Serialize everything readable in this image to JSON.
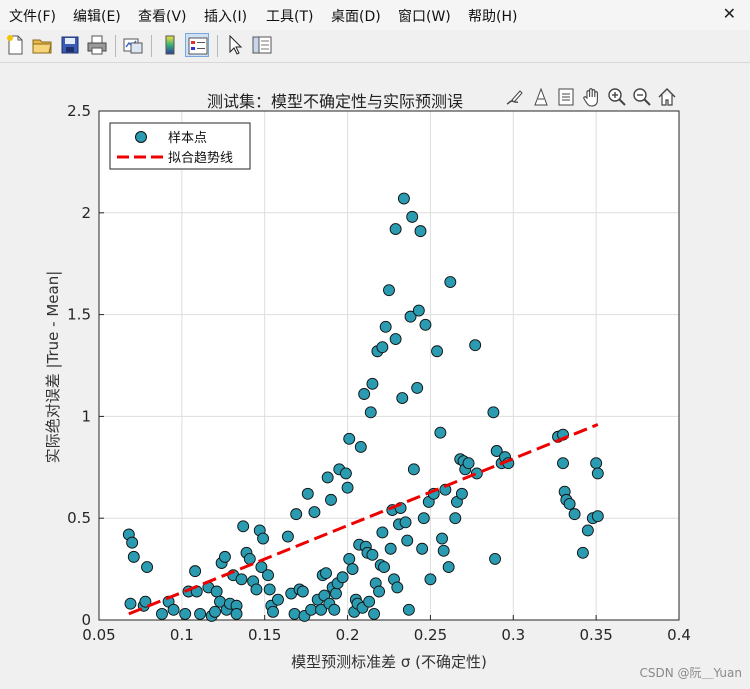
{
  "menu": {
    "items": [
      "文件(F)",
      "编辑(E)",
      "查看(V)",
      "插入(I)",
      "工具(T)",
      "桌面(D)",
      "窗口(W)",
      "帮助(H)"
    ]
  },
  "toolbar": {
    "icons": [
      "new-figure-icon",
      "open-file-icon",
      "save-icon",
      "print-icon",
      "link-plot-icon",
      "colorbar-icon",
      "legend-icon",
      "pointer-icon",
      "property-inspector-icon"
    ]
  },
  "axes_toolbar": {
    "icons": [
      "brush-icon",
      "data-tip-icon",
      "export-icon",
      "pan-hand-icon",
      "zoom-in-icon",
      "zoom-out-icon",
      "home-icon"
    ]
  },
  "watermark": "CSDN @阮＿Yuan",
  "chart_data": {
    "type": "scatter",
    "title": "测试集：模型不确定性与实际预测误",
    "xlabel": "模型预测标准差 σ (不确定性)",
    "ylabel": "实际绝对误差 |True - Mean|",
    "xlim": [
      0.05,
      0.4
    ],
    "ylim": [
      0,
      2.5
    ],
    "xticks": [
      0.05,
      0.1,
      0.15,
      0.2,
      0.25,
      0.3,
      0.35,
      0.4
    ],
    "xtick_labels": [
      "0.05",
      "0.1",
      "0.15",
      "0.2",
      "0.25",
      "0.3",
      "0.35",
      "0.4"
    ],
    "yticks": [
      0,
      0.5,
      1,
      1.5,
      2,
      2.5
    ],
    "ytick_labels": [
      "0",
      "0.5",
      "1",
      "1.5",
      "2",
      "2.5"
    ],
    "grid": true,
    "legend_position": "top-left",
    "colors": {
      "marker": "#2a9bb0",
      "marker_edge": "#111111",
      "trend": "#ee0000"
    },
    "series": [
      {
        "name": "样本点",
        "points": [
          [
            0.068,
            0.42
          ],
          [
            0.07,
            0.38
          ],
          [
            0.071,
            0.31
          ],
          [
            0.069,
            0.08
          ],
          [
            0.077,
            0.07
          ],
          [
            0.079,
            0.26
          ],
          [
            0.078,
            0.09
          ],
          [
            0.088,
            0.03
          ],
          [
            0.092,
            0.09
          ],
          [
            0.095,
            0.05
          ],
          [
            0.102,
            0.03
          ],
          [
            0.104,
            0.14
          ],
          [
            0.108,
            0.24
          ],
          [
            0.109,
            0.14
          ],
          [
            0.111,
            0.03
          ],
          [
            0.116,
            0.16
          ],
          [
            0.118,
            0.02
          ],
          [
            0.12,
            0.04
          ],
          [
            0.121,
            0.14
          ],
          [
            0.123,
            0.09
          ],
          [
            0.124,
            0.28
          ],
          [
            0.126,
            0.31
          ],
          [
            0.127,
            0.05
          ],
          [
            0.129,
            0.08
          ],
          [
            0.131,
            0.22
          ],
          [
            0.133,
            0.07
          ],
          [
            0.133,
            0.03
          ],
          [
            0.136,
            0.2
          ],
          [
            0.137,
            0.46
          ],
          [
            0.139,
            0.33
          ],
          [
            0.141,
            0.3
          ],
          [
            0.143,
            0.19
          ],
          [
            0.145,
            0.15
          ],
          [
            0.147,
            0.44
          ],
          [
            0.148,
            0.26
          ],
          [
            0.149,
            0.4
          ],
          [
            0.152,
            0.22
          ],
          [
            0.153,
            0.15
          ],
          [
            0.154,
            0.07
          ],
          [
            0.155,
            0.04
          ],
          [
            0.158,
            0.1
          ],
          [
            0.164,
            0.41
          ],
          [
            0.166,
            0.13
          ],
          [
            0.168,
            0.03
          ],
          [
            0.169,
            0.52
          ],
          [
            0.171,
            0.15
          ],
          [
            0.173,
            0.14
          ],
          [
            0.174,
            0.02
          ],
          [
            0.176,
            0.62
          ],
          [
            0.178,
            0.05
          ],
          [
            0.18,
            0.53
          ],
          [
            0.182,
            0.1
          ],
          [
            0.184,
            0.05
          ],
          [
            0.185,
            0.22
          ],
          [
            0.186,
            0.12
          ],
          [
            0.187,
            0.23
          ],
          [
            0.188,
            0.7
          ],
          [
            0.189,
            0.08
          ],
          [
            0.19,
            0.59
          ],
          [
            0.191,
            0.16
          ],
          [
            0.192,
            0.05
          ],
          [
            0.193,
            0.13
          ],
          [
            0.194,
            0.18
          ],
          [
            0.195,
            0.74
          ],
          [
            0.197,
            0.21
          ],
          [
            0.199,
            0.72
          ],
          [
            0.2,
            0.65
          ],
          [
            0.201,
            0.3
          ],
          [
            0.201,
            0.89
          ],
          [
            0.203,
            0.25
          ],
          [
            0.204,
            0.04
          ],
          [
            0.205,
            0.1
          ],
          [
            0.206,
            0.08
          ],
          [
            0.207,
            0.37
          ],
          [
            0.208,
            0.85
          ],
          [
            0.209,
            0.06
          ],
          [
            0.21,
            1.11
          ],
          [
            0.211,
            0.36
          ],
          [
            0.212,
            0.33
          ],
          [
            0.213,
            0.09
          ],
          [
            0.214,
            1.02
          ],
          [
            0.215,
            1.16
          ],
          [
            0.215,
            0.32
          ],
          [
            0.216,
            0.03
          ],
          [
            0.217,
            0.18
          ],
          [
            0.218,
            1.32
          ],
          [
            0.219,
            0.14
          ],
          [
            0.22,
            0.27
          ],
          [
            0.221,
            0.43
          ],
          [
            0.221,
            1.34
          ],
          [
            0.222,
            0.26
          ],
          [
            0.223,
            1.44
          ],
          [
            0.225,
            1.62
          ],
          [
            0.226,
            0.35
          ],
          [
            0.227,
            0.54
          ],
          [
            0.228,
            0.2
          ],
          [
            0.229,
            1.92
          ],
          [
            0.229,
            1.38
          ],
          [
            0.23,
            0.16
          ],
          [
            0.231,
            0.47
          ],
          [
            0.232,
            0.55
          ],
          [
            0.233,
            1.09
          ],
          [
            0.234,
            2.07
          ],
          [
            0.235,
            0.48
          ],
          [
            0.236,
            0.39
          ],
          [
            0.237,
            0.05
          ],
          [
            0.238,
            1.49
          ],
          [
            0.239,
            1.98
          ],
          [
            0.24,
            0.74
          ],
          [
            0.242,
            1.14
          ],
          [
            0.243,
            1.52
          ],
          [
            0.244,
            1.91
          ],
          [
            0.245,
            0.35
          ],
          [
            0.246,
            0.5
          ],
          [
            0.247,
            1.45
          ],
          [
            0.249,
            0.58
          ],
          [
            0.25,
            0.2
          ],
          [
            0.252,
            0.62
          ],
          [
            0.254,
            1.32
          ],
          [
            0.256,
            0.92
          ],
          [
            0.257,
            0.4
          ],
          [
            0.258,
            0.34
          ],
          [
            0.259,
            0.64
          ],
          [
            0.261,
            0.26
          ],
          [
            0.262,
            1.66
          ],
          [
            0.265,
            0.5
          ],
          [
            0.266,
            0.58
          ],
          [
            0.268,
            0.79
          ],
          [
            0.269,
            0.62
          ],
          [
            0.27,
            0.78
          ],
          [
            0.271,
            0.74
          ],
          [
            0.273,
            0.77
          ],
          [
            0.277,
            1.35
          ],
          [
            0.278,
            0.72
          ],
          [
            0.288,
            1.02
          ],
          [
            0.289,
            0.3
          ],
          [
            0.29,
            0.83
          ],
          [
            0.293,
            0.77
          ],
          [
            0.295,
            0.8
          ],
          [
            0.297,
            0.77
          ],
          [
            0.327,
            0.9
          ],
          [
            0.33,
            0.91
          ],
          [
            0.33,
            0.77
          ],
          [
            0.331,
            0.63
          ],
          [
            0.332,
            0.59
          ],
          [
            0.334,
            0.57
          ],
          [
            0.337,
            0.52
          ],
          [
            0.342,
            0.33
          ],
          [
            0.345,
            0.44
          ],
          [
            0.348,
            0.5
          ],
          [
            0.35,
            0.77
          ],
          [
            0.351,
            0.72
          ],
          [
            0.351,
            0.51
          ]
        ]
      },
      {
        "name": "拟合趋势线",
        "type": "line",
        "style": "dashed",
        "x": [
          0.068,
          0.351
        ],
        "y": [
          0.03,
          0.96
        ]
      }
    ]
  }
}
